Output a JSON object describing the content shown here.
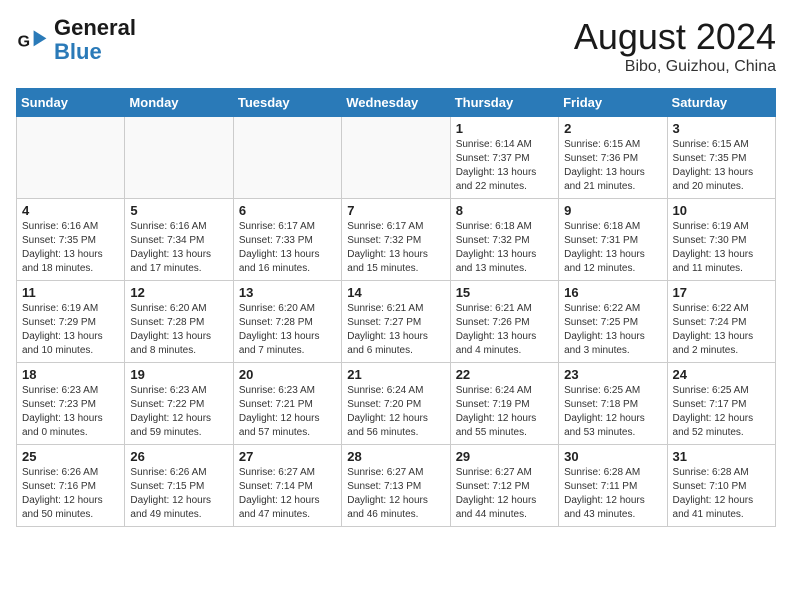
{
  "header": {
    "logo_general": "General",
    "logo_blue": "Blue",
    "month_title": "August 2024",
    "location": "Bibo, Guizhou, China"
  },
  "days_of_week": [
    "Sunday",
    "Monday",
    "Tuesday",
    "Wednesday",
    "Thursday",
    "Friday",
    "Saturday"
  ],
  "weeks": [
    [
      {
        "num": "",
        "info": ""
      },
      {
        "num": "",
        "info": ""
      },
      {
        "num": "",
        "info": ""
      },
      {
        "num": "",
        "info": ""
      },
      {
        "num": "1",
        "info": "Sunrise: 6:14 AM\nSunset: 7:37 PM\nDaylight: 13 hours\nand 22 minutes."
      },
      {
        "num": "2",
        "info": "Sunrise: 6:15 AM\nSunset: 7:36 PM\nDaylight: 13 hours\nand 21 minutes."
      },
      {
        "num": "3",
        "info": "Sunrise: 6:15 AM\nSunset: 7:35 PM\nDaylight: 13 hours\nand 20 minutes."
      }
    ],
    [
      {
        "num": "4",
        "info": "Sunrise: 6:16 AM\nSunset: 7:35 PM\nDaylight: 13 hours\nand 18 minutes."
      },
      {
        "num": "5",
        "info": "Sunrise: 6:16 AM\nSunset: 7:34 PM\nDaylight: 13 hours\nand 17 minutes."
      },
      {
        "num": "6",
        "info": "Sunrise: 6:17 AM\nSunset: 7:33 PM\nDaylight: 13 hours\nand 16 minutes."
      },
      {
        "num": "7",
        "info": "Sunrise: 6:17 AM\nSunset: 7:32 PM\nDaylight: 13 hours\nand 15 minutes."
      },
      {
        "num": "8",
        "info": "Sunrise: 6:18 AM\nSunset: 7:32 PM\nDaylight: 13 hours\nand 13 minutes."
      },
      {
        "num": "9",
        "info": "Sunrise: 6:18 AM\nSunset: 7:31 PM\nDaylight: 13 hours\nand 12 minutes."
      },
      {
        "num": "10",
        "info": "Sunrise: 6:19 AM\nSunset: 7:30 PM\nDaylight: 13 hours\nand 11 minutes."
      }
    ],
    [
      {
        "num": "11",
        "info": "Sunrise: 6:19 AM\nSunset: 7:29 PM\nDaylight: 13 hours\nand 10 minutes."
      },
      {
        "num": "12",
        "info": "Sunrise: 6:20 AM\nSunset: 7:28 PM\nDaylight: 13 hours\nand 8 minutes."
      },
      {
        "num": "13",
        "info": "Sunrise: 6:20 AM\nSunset: 7:28 PM\nDaylight: 13 hours\nand 7 minutes."
      },
      {
        "num": "14",
        "info": "Sunrise: 6:21 AM\nSunset: 7:27 PM\nDaylight: 13 hours\nand 6 minutes."
      },
      {
        "num": "15",
        "info": "Sunrise: 6:21 AM\nSunset: 7:26 PM\nDaylight: 13 hours\nand 4 minutes."
      },
      {
        "num": "16",
        "info": "Sunrise: 6:22 AM\nSunset: 7:25 PM\nDaylight: 13 hours\nand 3 minutes."
      },
      {
        "num": "17",
        "info": "Sunrise: 6:22 AM\nSunset: 7:24 PM\nDaylight: 13 hours\nand 2 minutes."
      }
    ],
    [
      {
        "num": "18",
        "info": "Sunrise: 6:23 AM\nSunset: 7:23 PM\nDaylight: 13 hours\nand 0 minutes."
      },
      {
        "num": "19",
        "info": "Sunrise: 6:23 AM\nSunset: 7:22 PM\nDaylight: 12 hours\nand 59 minutes."
      },
      {
        "num": "20",
        "info": "Sunrise: 6:23 AM\nSunset: 7:21 PM\nDaylight: 12 hours\nand 57 minutes."
      },
      {
        "num": "21",
        "info": "Sunrise: 6:24 AM\nSunset: 7:20 PM\nDaylight: 12 hours\nand 56 minutes."
      },
      {
        "num": "22",
        "info": "Sunrise: 6:24 AM\nSunset: 7:19 PM\nDaylight: 12 hours\nand 55 minutes."
      },
      {
        "num": "23",
        "info": "Sunrise: 6:25 AM\nSunset: 7:18 PM\nDaylight: 12 hours\nand 53 minutes."
      },
      {
        "num": "24",
        "info": "Sunrise: 6:25 AM\nSunset: 7:17 PM\nDaylight: 12 hours\nand 52 minutes."
      }
    ],
    [
      {
        "num": "25",
        "info": "Sunrise: 6:26 AM\nSunset: 7:16 PM\nDaylight: 12 hours\nand 50 minutes."
      },
      {
        "num": "26",
        "info": "Sunrise: 6:26 AM\nSunset: 7:15 PM\nDaylight: 12 hours\nand 49 minutes."
      },
      {
        "num": "27",
        "info": "Sunrise: 6:27 AM\nSunset: 7:14 PM\nDaylight: 12 hours\nand 47 minutes."
      },
      {
        "num": "28",
        "info": "Sunrise: 6:27 AM\nSunset: 7:13 PM\nDaylight: 12 hours\nand 46 minutes."
      },
      {
        "num": "29",
        "info": "Sunrise: 6:27 AM\nSunset: 7:12 PM\nDaylight: 12 hours\nand 44 minutes."
      },
      {
        "num": "30",
        "info": "Sunrise: 6:28 AM\nSunset: 7:11 PM\nDaylight: 12 hours\nand 43 minutes."
      },
      {
        "num": "31",
        "info": "Sunrise: 6:28 AM\nSunset: 7:10 PM\nDaylight: 12 hours\nand 41 minutes."
      }
    ]
  ]
}
